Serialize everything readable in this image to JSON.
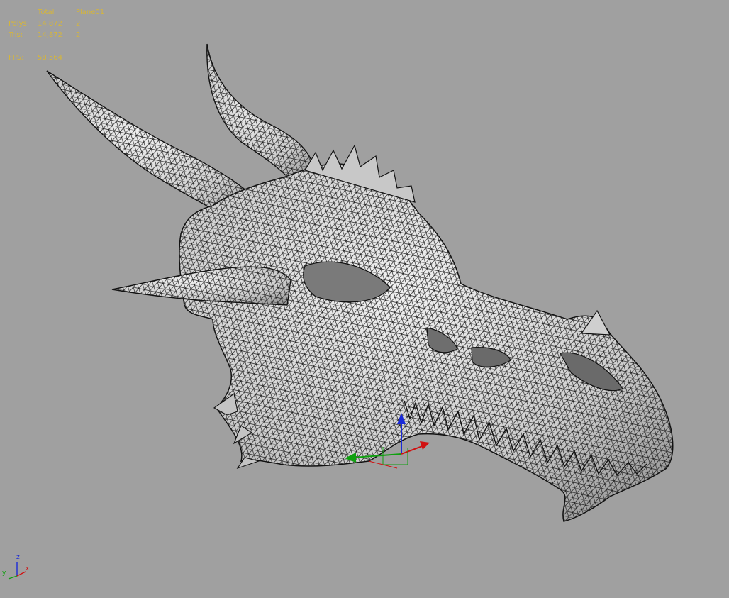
{
  "stats": {
    "header": {
      "total": "Total",
      "selection": "Plane01"
    },
    "rows": [
      {
        "label": "Polys:",
        "total": "14,872",
        "selection": "2"
      },
      {
        "label": "Tris:",
        "total": "14,872",
        "selection": "2"
      }
    ],
    "fps": {
      "label": "FPS:",
      "value": "58.564"
    }
  },
  "view_gizmo": {
    "x": "x",
    "y": "y",
    "z": "z"
  },
  "colors": {
    "background": "#a0a0a0",
    "stats_text": "#d6b63a",
    "mesh_fill": "#d2d2d2",
    "wire": "#111111",
    "axis_x": "#d01010",
    "axis_y": "#10a010",
    "axis_z": "#1a2ad8"
  }
}
